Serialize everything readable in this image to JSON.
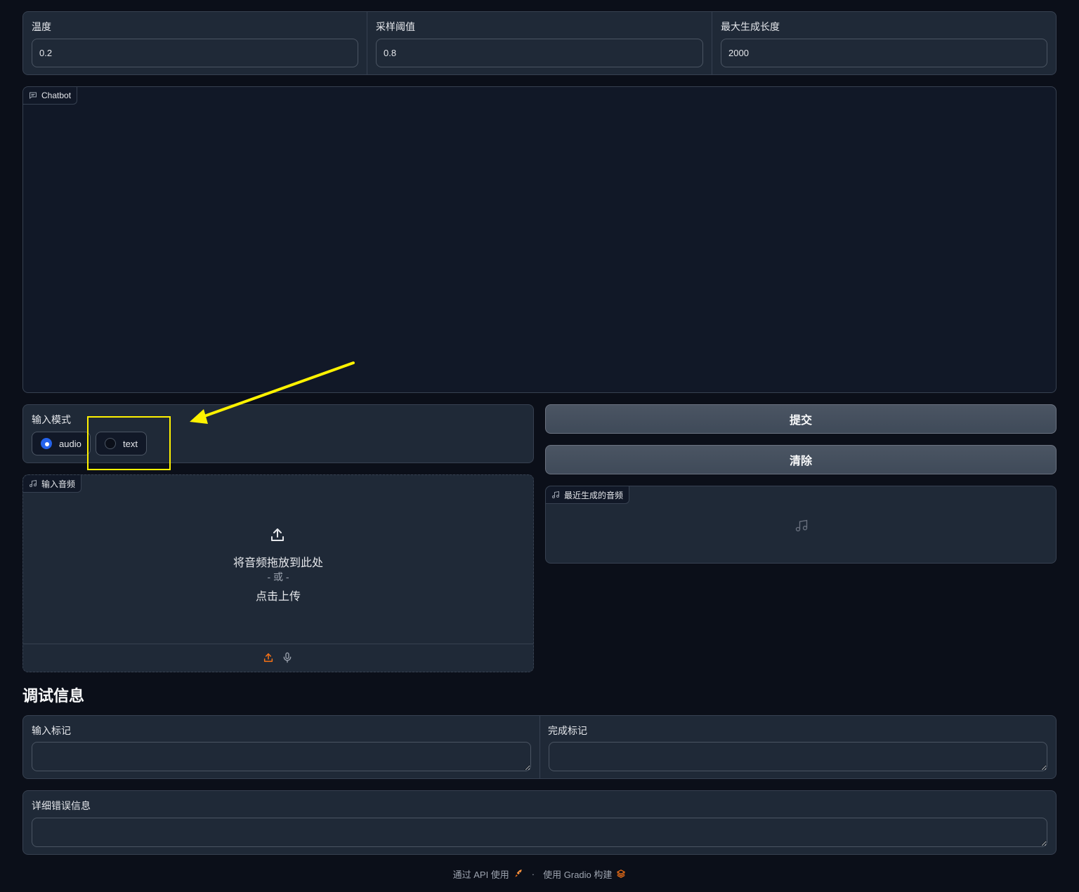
{
  "params": {
    "temperature": {
      "label": "温度",
      "value": "0.2"
    },
    "top_p": {
      "label": "采样阈值",
      "value": "0.8"
    },
    "max_length": {
      "label": "最大生成长度",
      "value": "2000"
    }
  },
  "chatbot": {
    "label": "Chatbot"
  },
  "input_mode": {
    "label": "输入模式",
    "options": [
      {
        "label": "audio",
        "selected": true
      },
      {
        "label": "text",
        "selected": false
      }
    ]
  },
  "buttons": {
    "submit": "提交",
    "clear": "清除"
  },
  "audio_input": {
    "label": "输入音频",
    "drop_text": "将音频拖放到此处",
    "or_text": "- 或 -",
    "click_text": "点击上传"
  },
  "audio_output": {
    "label": "最近生成的音频"
  },
  "debug": {
    "heading": "调试信息",
    "input_tokens_label": "输入标记",
    "completion_tokens_label": "完成标记",
    "error_label": "详细错误信息"
  },
  "footer": {
    "api_text": "通过 API 使用",
    "separator": "·",
    "built_text": "使用 Gradio 构建"
  },
  "colors": {
    "background": "#0b0f19",
    "panel": "#1f2937",
    "accent_radio": "#2563eb",
    "upload_icon": "#f97316",
    "annotation": "#fff200"
  },
  "annotation": {
    "description": "yellow highlight box and arrow pointing to the text option"
  }
}
